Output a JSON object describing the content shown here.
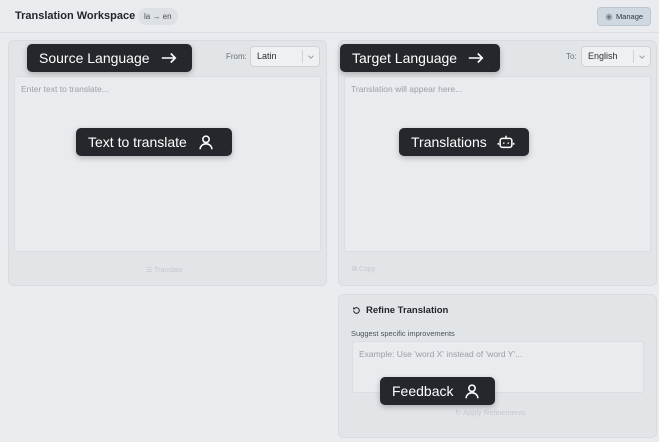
{
  "header": {
    "title": "Translation Workspace",
    "lang_pair": "la → en",
    "manage_label": "Manage"
  },
  "source": {
    "from_label": "From:",
    "language": "Latin",
    "placeholder": "Enter text to translate...",
    "action_label": "Translate"
  },
  "target": {
    "to_label": "To:",
    "language": "English",
    "placeholder": "Translation will appear here...",
    "action_label": "Copy"
  },
  "refine": {
    "title": "Refine Translation",
    "subtitle": "Suggest specific improvements",
    "placeholder": "Example: Use 'word X' instead of 'word Y'...",
    "apply_label": "Apply Refinements"
  },
  "callouts": {
    "source_language": "Source Language",
    "target_language": "Target Language",
    "text_to_translate": "Text to translate",
    "translations": "Translations",
    "feedback": "Feedback"
  },
  "icons": {
    "manage": "gear-icon",
    "refine": "refresh-icon",
    "arrow": "arrow-right-icon",
    "user": "user-icon",
    "bot": "bot-icon"
  }
}
